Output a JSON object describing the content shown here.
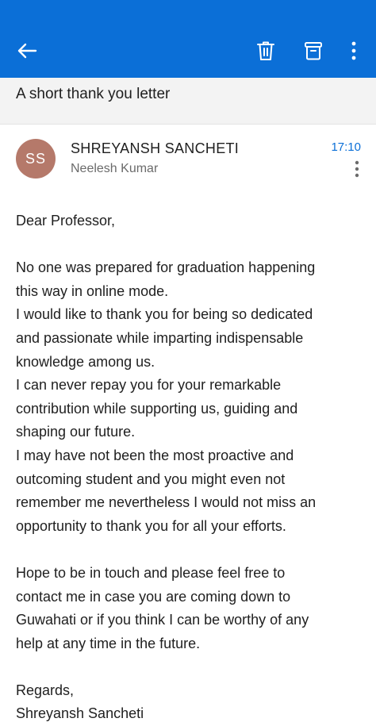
{
  "toolbar": {
    "back_icon": "arrow-left-icon",
    "delete_icon": "trash-icon",
    "archive_icon": "archive-icon",
    "more_icon": "more-vertical-icon",
    "background_color": "#0b6fd7"
  },
  "email": {
    "subject": "A short thank you letter",
    "sender": {
      "initials": "SS",
      "name": "SHREYANSH SANCHETI",
      "avatar_color": "#b5796a"
    },
    "recipient": "Neelesh Kumar",
    "time": "17:10",
    "body": {
      "greeting": "Dear Professor,",
      "paragraph1": [
        "No one was prepared for graduation happening",
        "this way in online mode.",
        "I would like to thank you for being so dedicated",
        "and passionate while imparting indispensable",
        "knowledge among us.",
        "I can never repay you for your remarkable",
        "contribution while supporting us, guiding and",
        "shaping our future.",
        "I may have not been the most proactive and",
        "outcoming student and you might even not",
        "remember me nevertheless I would not miss an",
        "opportunity to thank you for all your efforts."
      ],
      "paragraph2": [
        "Hope to be in touch and please feel free to",
        "contact me in case you are coming down to",
        "Guwahati or if you think I can be worthy of any",
        "help at any time in the future."
      ],
      "closing": "Regards,",
      "signature": "Shreyansh Sancheti"
    }
  }
}
